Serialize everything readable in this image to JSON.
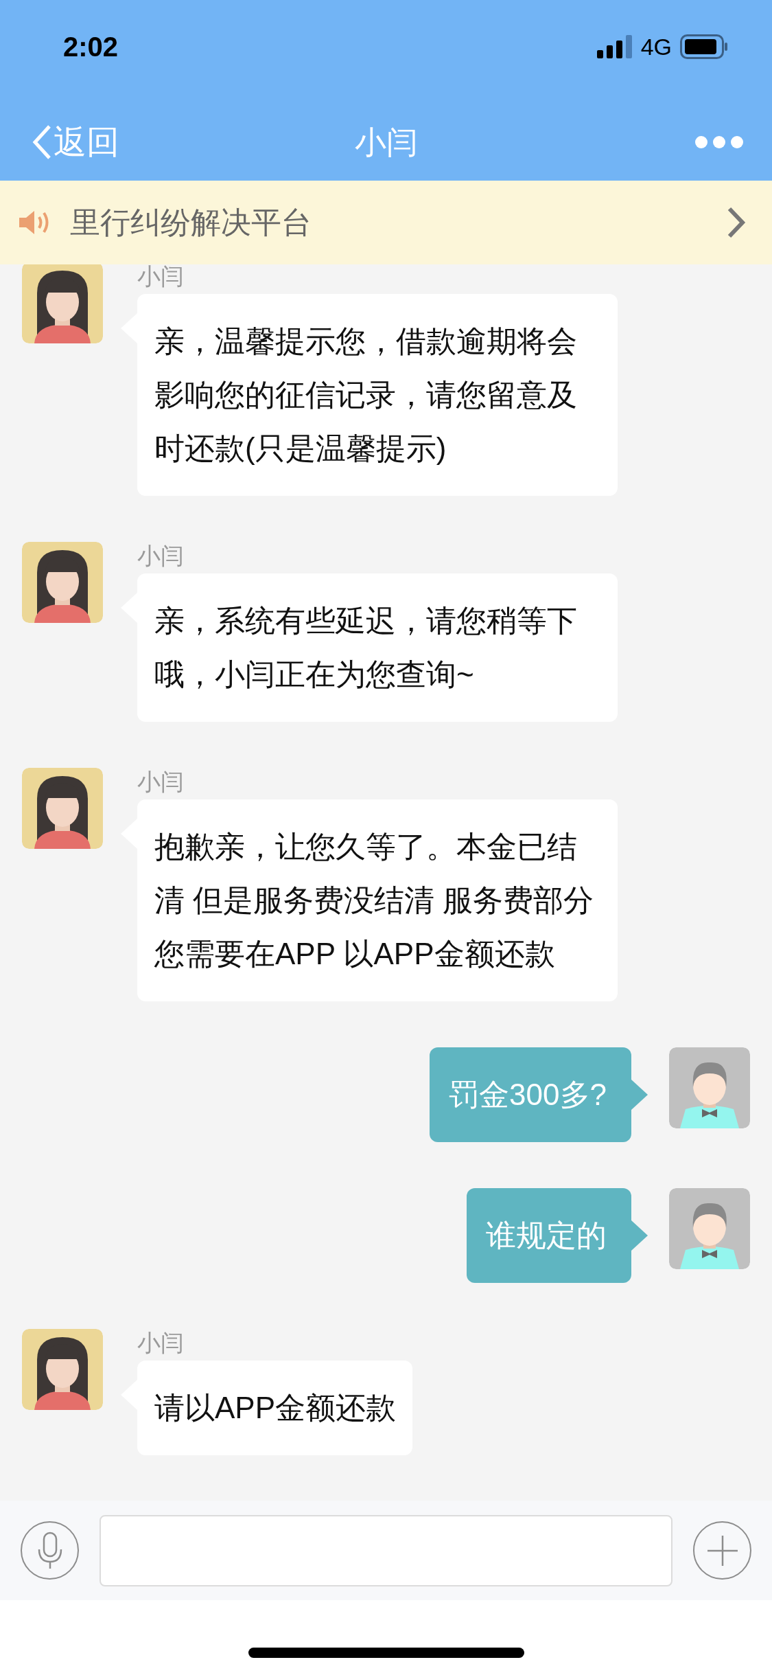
{
  "status_bar": {
    "time": "2:02",
    "network": "4G"
  },
  "nav_bar": {
    "back": "返回",
    "title": "小闫"
  },
  "notice": {
    "text": "里行纠纷解决平台"
  },
  "messages": [
    {
      "kind": "received",
      "sender": "小闫",
      "text": "亲，温馨提示您，借款逾期将会影响您的征信记录，请您留意及时还款(只是温馨提示)"
    },
    {
      "kind": "received",
      "sender": "小闫",
      "text": "亲，系统有些延迟，请您稍等下哦，小闫正在为您查询~"
    },
    {
      "kind": "received",
      "sender": "小闫",
      "text": "抱歉亲，让您久等了。本金已结清 但是服务费没结清 服务费部分您需要在APP 以APP金额还款"
    },
    {
      "kind": "sent",
      "text": "罚金300多?"
    },
    {
      "kind": "sent",
      "text": "谁规定的"
    },
    {
      "kind": "received",
      "sender": "小闫",
      "text": "请以APP金额还款"
    }
  ]
}
